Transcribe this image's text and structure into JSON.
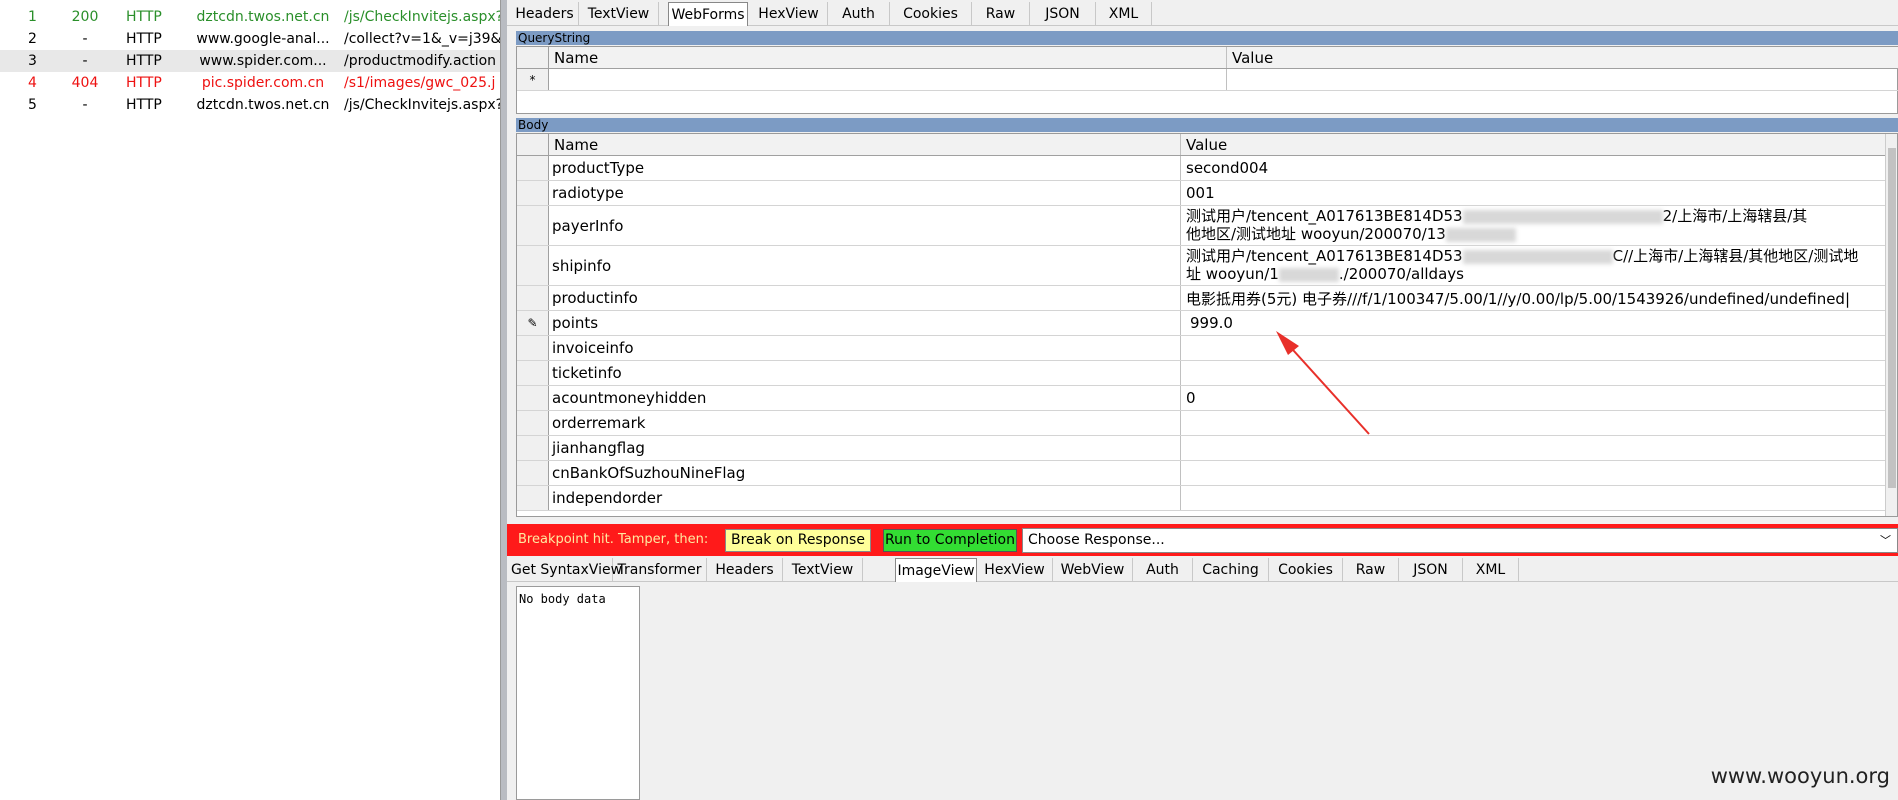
{
  "sessions": [
    {
      "icon": "js-file-icon",
      "num": "1",
      "result": "200",
      "protocol": "HTTP",
      "host": "dztcdn.twos.net.cn",
      "url": "/js/CheckInvitejs.aspx?",
      "color": "#2a8f2a"
    },
    {
      "icon": "breakpoint-icon",
      "num": "2",
      "result": "-",
      "protocol": "HTTP",
      "host": "www.google-anal...",
      "url": "/collect?v=1&_v=j39&",
      "color": "#000000"
    },
    {
      "icon": "breakpoint-icon",
      "num": "3",
      "result": "-",
      "protocol": "HTTP",
      "host": "www.spider.com...",
      "url": "/productmodify.action",
      "color": "#000000"
    },
    {
      "icon": "warning-icon",
      "num": "4",
      "result": "404",
      "protocol": "HTTP",
      "host": "pic.spider.com.cn",
      "url": "/s1/images/gwc_025.j",
      "color": "#e11111"
    },
    {
      "icon": "breakpoint-icon",
      "num": "5",
      "result": "-",
      "protocol": "HTTP",
      "host": "dztcdn.twos.net.cn",
      "url": "/js/CheckInvitejs.aspx?",
      "color": "#000000"
    }
  ],
  "request_tabs": [
    "Headers",
    "TextView",
    "WebForms",
    "HexView",
    "Auth",
    "Cookies",
    "Raw",
    "JSON",
    "XML"
  ],
  "request_active_tab": "WebForms",
  "querystring": {
    "header": "QueryString",
    "col_name": "Name",
    "col_value": "Value",
    "new_row_marker": "*"
  },
  "body": {
    "header": "Body",
    "col_name": "Name",
    "col_value": "Value",
    "rows": [
      {
        "name": "productType",
        "value": "second004"
      },
      {
        "name": "radiotype",
        "value": "001"
      },
      {
        "name": "payerInfo",
        "value_line1": "测试用户/tencent_A017613BE814D53",
        "value_line1_end": "2/上海市/上海辖县/其",
        "value_line2": "他地区/测试地址 wooyun/200070/13"
      },
      {
        "name": "shipinfo",
        "value_line1": "测试用户/tencent_A017613BE814D53",
        "value_line1_end": "C//上海市/上海辖县/其他地区/测试地",
        "value_line2": "址 wooyun/1",
        "value_line2_end": "./200070/alldays"
      },
      {
        "name": "productinfo",
        "value": "电影抵用券(5元) 电子券///f/1/100347/5.00/1//y/0.00/lp/5.00/1543926/undefined/undefined|"
      },
      {
        "name": "points",
        "value": "999.0",
        "editing": true,
        "edit_marker": "✎"
      },
      {
        "name": "invoiceinfo",
        "value": ""
      },
      {
        "name": "ticketinfo",
        "value": ""
      },
      {
        "name": "acountmoneyhidden",
        "value": "0"
      },
      {
        "name": "orderremark",
        "value": ""
      },
      {
        "name": "jianhangflag",
        "value": ""
      },
      {
        "name": "cnBankOfSuzhouNineFlag",
        "value": ""
      },
      {
        "name": "independorder",
        "value": ""
      }
    ]
  },
  "breakpoint": {
    "message": "Breakpoint hit. Tamper, then:",
    "break_on_response": "Break on Response",
    "run_to_completion": "Run to Completion",
    "choose_response": "Choose Response..."
  },
  "response_tabs": [
    "Get SyntaxView",
    "Transformer",
    "Headers",
    "TextView",
    "ImageView",
    "HexView",
    "WebView",
    "Auth",
    "Caching",
    "Cookies",
    "Raw",
    "JSON",
    "XML"
  ],
  "response_active_tab": "ImageView",
  "response_body": "No body data",
  "watermark": "www.wooyun.org",
  "colors": {
    "breakpoint_bar": "#ff1a1a",
    "run_button": "#33dd33",
    "break_button": "#ffff99",
    "section_header": "#7c9bc4",
    "arrow": "#e8302a"
  }
}
